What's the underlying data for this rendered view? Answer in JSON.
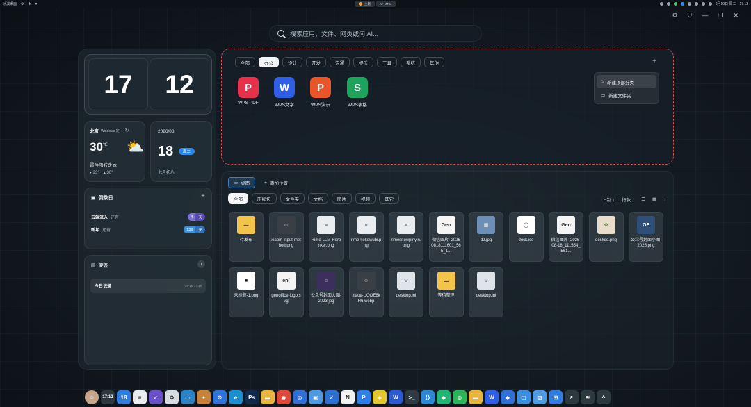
{
  "sysbar": {
    "app_name": "冰淇桌面",
    "center_left": "主题",
    "center_right": "XPC",
    "datetime": "8月18日 周二",
    "time": "17:12"
  },
  "search": {
    "placeholder": "搜索应用、文件、网页或问 AI..."
  },
  "clock": {
    "hour": "17",
    "minute": "12"
  },
  "weather": {
    "location": "北京",
    "source": "Windows 定···",
    "temp": "30",
    "unit": "℃",
    "desc": "雷阵雨转多云",
    "low": "23°",
    "high": "30°"
  },
  "date_widget": {
    "year_month": "2026/08",
    "day": "18",
    "weekday": "周二",
    "lunar": "七月初八"
  },
  "countdown": {
    "title": "倒数日",
    "items": [
      {
        "name": "云端流入",
        "sub": "还有",
        "count": "4",
        "unit": "天"
      },
      {
        "name": "新年",
        "sub": "还有",
        "count": "136",
        "unit": "天"
      }
    ]
  },
  "notes": {
    "title": "便签",
    "count": "1",
    "item_title": "今日记录",
    "item_time": "08-18 17:48"
  },
  "categories": [
    "全部",
    "办公",
    "设计",
    "开发",
    "沟通",
    "娱乐",
    "工具",
    "系统",
    "其他"
  ],
  "apps": [
    {
      "label": "WPS PDF",
      "glyph": "P",
      "color": "#e5324a"
    },
    {
      "label": "WPS文字",
      "glyph": "W",
      "color": "#2f5fe4"
    },
    {
      "label": "WPS演示",
      "glyph": "P",
      "color": "#e9542b"
    },
    {
      "label": "WPS表格",
      "glyph": "S",
      "color": "#1da35c"
    }
  ],
  "context_menu": [
    "新建顶部分类",
    "新建文件夹"
  ],
  "files_header": {
    "desktop_tab": "桌面",
    "add_location": "添加位置"
  },
  "file_filters": [
    "全部",
    "压缩包",
    "文件夹",
    "文档",
    "图片",
    "视频",
    "其它"
  ],
  "sort_bar": {
    "sort": "H制 ↓",
    "order": "行款 ↑"
  },
  "files": [
    {
      "name": "待发布",
      "kind": "folder"
    },
    {
      "name": "xiapin-input-method.png",
      "kind": "img-dark"
    },
    {
      "name": "Rime-LLM-Reranker.png",
      "kind": "img-doc"
    },
    {
      "name": "rime-kekewubi.png",
      "kind": "img-doc"
    },
    {
      "name": "rimesnowpinyin.png",
      "kind": "img-doc"
    },
    {
      "name": "微信图片_20260818111601_565_1...",
      "kind": "img-gen"
    },
    {
      "name": "d2.jpg",
      "kind": "img-blue"
    },
    {
      "name": "dock.ico",
      "kind": "img-ring"
    },
    {
      "name": "微信图片_2026-08-18_111554_561...",
      "kind": "img-gen"
    },
    {
      "name": "deskqq.png",
      "kind": "img-colorful"
    },
    {
      "name": "公众号封面小图-2025.png",
      "kind": "img-of"
    },
    {
      "name": "未标题-1.png",
      "kind": "img-black"
    },
    {
      "name": "genoffice-logo.svg",
      "kind": "img-gen2"
    },
    {
      "name": "公众号封面大图-2023.jpg",
      "kind": "img-purple"
    },
    {
      "name": "xiaoe-UQOE6kH6.webp",
      "kind": "img-dark"
    },
    {
      "name": "desktop.ini",
      "kind": "gear"
    },
    {
      "name": "等待整理",
      "kind": "folder"
    },
    {
      "name": "desktop.ini",
      "kind": "gear"
    }
  ],
  "taskbar": {
    "clock": "17:12",
    "calendar_day": "18",
    "icons": [
      {
        "name": "avatar",
        "color": "#c9a58a"
      },
      {
        "name": "clock-widget",
        "color": "#2c3a40"
      },
      {
        "name": "calendar",
        "color": "#2f7de0"
      },
      {
        "name": "notes",
        "color": "#e8ecef"
      },
      {
        "name": "tasks",
        "color": "#6a4fc9"
      },
      {
        "name": "recycle-bin",
        "color": "#d8dde2"
      },
      {
        "name": "monitor",
        "color": "#2a83c8"
      },
      {
        "name": "game",
        "color": "#c8823a"
      },
      {
        "name": "settings",
        "color": "#2f72d8"
      },
      {
        "name": "edge",
        "color": "#1b8fd0"
      },
      {
        "name": "photoshop",
        "color": "#0f2a4a"
      },
      {
        "name": "files",
        "color": "#e9b53d"
      },
      {
        "name": "chrome",
        "color": "#e0483a"
      },
      {
        "name": "browser",
        "color": "#2f6fd6"
      },
      {
        "name": "store",
        "color": "#4f9be3"
      },
      {
        "name": "todo",
        "color": "#2d6fd1"
      },
      {
        "name": "notion",
        "color": "#f2f2f2"
      },
      {
        "name": "pixso",
        "color": "#2d7ee8"
      },
      {
        "name": "scanner",
        "color": "#e4c72f"
      },
      {
        "name": "word",
        "color": "#2a5bd5"
      },
      {
        "name": "terminal",
        "color": "#2f3a40"
      },
      {
        "name": "vscode",
        "color": "#2d87d5"
      },
      {
        "name": "app-green",
        "color": "#23b573"
      },
      {
        "name": "wechat",
        "color": "#2bb65a"
      },
      {
        "name": "folder",
        "color": "#e9b53d"
      },
      {
        "name": "wps-writer",
        "color": "#2f5fe4"
      },
      {
        "name": "app-blue",
        "color": "#2f6fd6"
      },
      {
        "name": "app-square",
        "color": "#3a8fe0"
      },
      {
        "name": "app-photo",
        "color": "#4f9be3"
      },
      {
        "name": "windows",
        "color": "#2f7de0"
      },
      {
        "name": "search",
        "color": "#2c3a40"
      },
      {
        "name": "wifi",
        "color": "#2c3a40"
      },
      {
        "name": "chevron",
        "color": "#2c3a40"
      }
    ]
  }
}
